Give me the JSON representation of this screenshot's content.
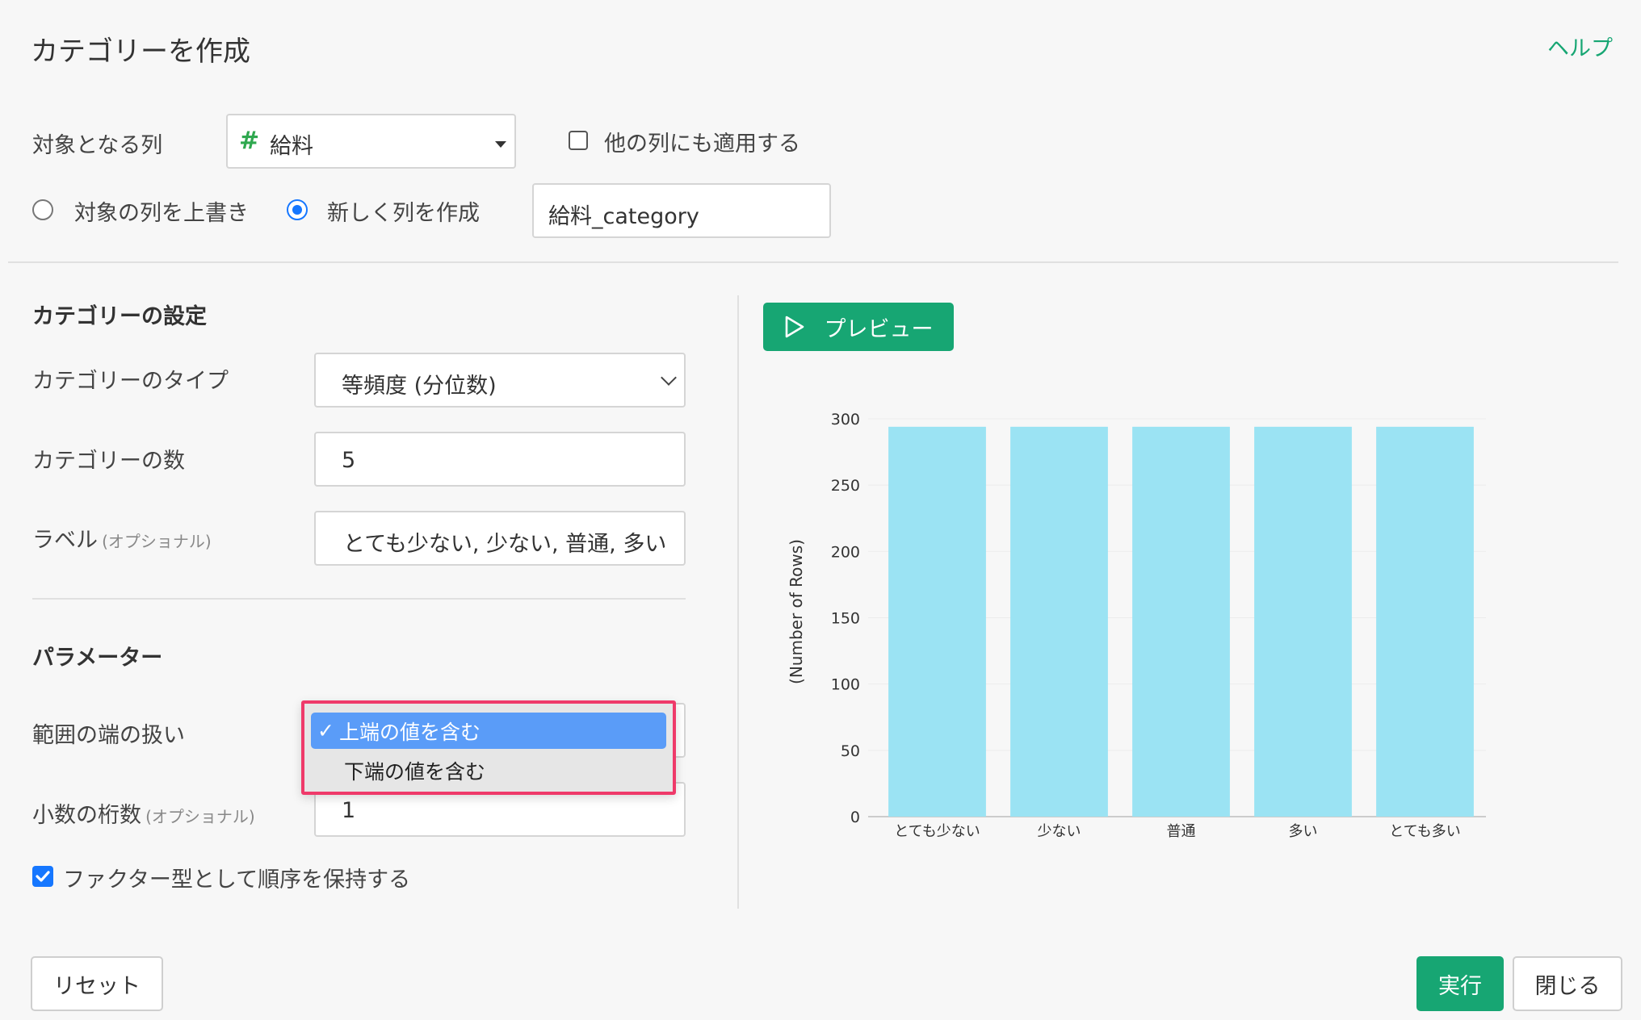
{
  "header": {
    "title": "カテゴリーを作成",
    "help": "ヘルプ"
  },
  "target": {
    "label": "対象となる列",
    "column_icon": "#",
    "column_value": "給料",
    "apply_others_label": "他の列にも適用する",
    "apply_others_checked": false
  },
  "mode": {
    "overwrite_label": "対象の列を上書き",
    "new_label": "新しく列を作成",
    "selected": "new",
    "new_column_name": "給料_category"
  },
  "settings": {
    "section_title": "カテゴリーの設定",
    "type_label": "カテゴリーのタイプ",
    "type_value": "等頻度 (分位数)",
    "count_label": "カテゴリーの数",
    "count_value": "5",
    "labels_label": "ラベル",
    "labels_note": "(オプショナル)",
    "labels_value": "とても少ない, 少ない, 普通, 多い"
  },
  "params": {
    "section_title": "パラメーター",
    "range_label": "範囲の端の扱い",
    "range_options": [
      "上端の値を含む",
      "下端の値を含む"
    ],
    "range_selected_mark": "✓",
    "decimals_label": "小数の桁数",
    "decimals_note": "(オプショナル)",
    "decimals_value": "1",
    "factor_label": "ファクター型として順序を保持する",
    "factor_checked": true
  },
  "preview": {
    "button_label": "プレビュー"
  },
  "chart_data": {
    "type": "bar",
    "categories": [
      "とても少ない",
      "少ない",
      "普通",
      "多い",
      "とても多い"
    ],
    "values": [
      294,
      294,
      294,
      294,
      294
    ],
    "ylabel": "(Number of Rows)",
    "xlabel": "",
    "ylim": [
      0,
      300
    ],
    "yticks": [
      0,
      50,
      100,
      150,
      200,
      250,
      300
    ],
    "bar_color": "#9be3f3"
  },
  "footer": {
    "reset": "リセット",
    "run": "実行",
    "close": "閉じる"
  },
  "colors": {
    "accent": "#17a673",
    "highlight_border": "#ef3a6a",
    "selected_option": "#5a9cf8"
  }
}
